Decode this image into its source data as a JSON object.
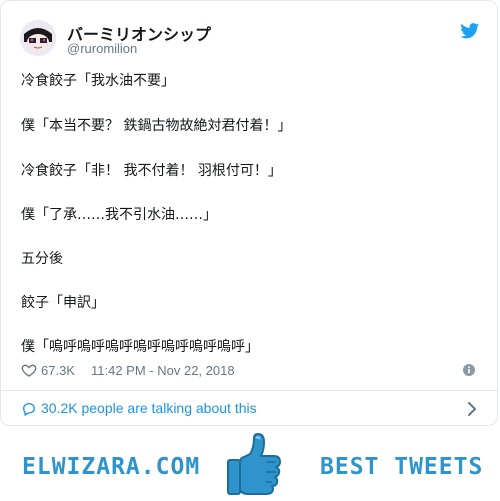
{
  "tweet": {
    "display_name": "バーミリオンシップ",
    "handle": "@ruromilion",
    "lines": [
      "冷食餃子「我水油不要」",
      "僕「本当不要？ 鉄鍋古物故絶対君付着！」",
      "冷食餃子「非！ 我不付着！ 羽根付可！」",
      "僕「了承……我不引水油……」",
      "五分後",
      "餃子「申訳」",
      "僕「嗚呼嗚呼嗚呼嗚呼嗚呼嗚呼嗚呼」"
    ],
    "likes": "67.3K",
    "timestamp": "11:42 PM - Nov 22, 2018",
    "talking": "30.2K people are talking about this"
  },
  "banner": {
    "left_text": "ELWIZARA.COM",
    "right_text": "BEST TWEETS"
  },
  "colors": {
    "brand_blue": "#1da1f2",
    "link_blue": "#1b95e0",
    "banner_blue": "#2f93cc",
    "muted": "#657786"
  },
  "icons": {
    "bird": "twitter-bird-icon",
    "heart": "heart-icon",
    "info": "info-icon",
    "comment": "comment-icon",
    "chevron": "chevron-right-icon",
    "thumb": "thumbs-up-icon"
  }
}
